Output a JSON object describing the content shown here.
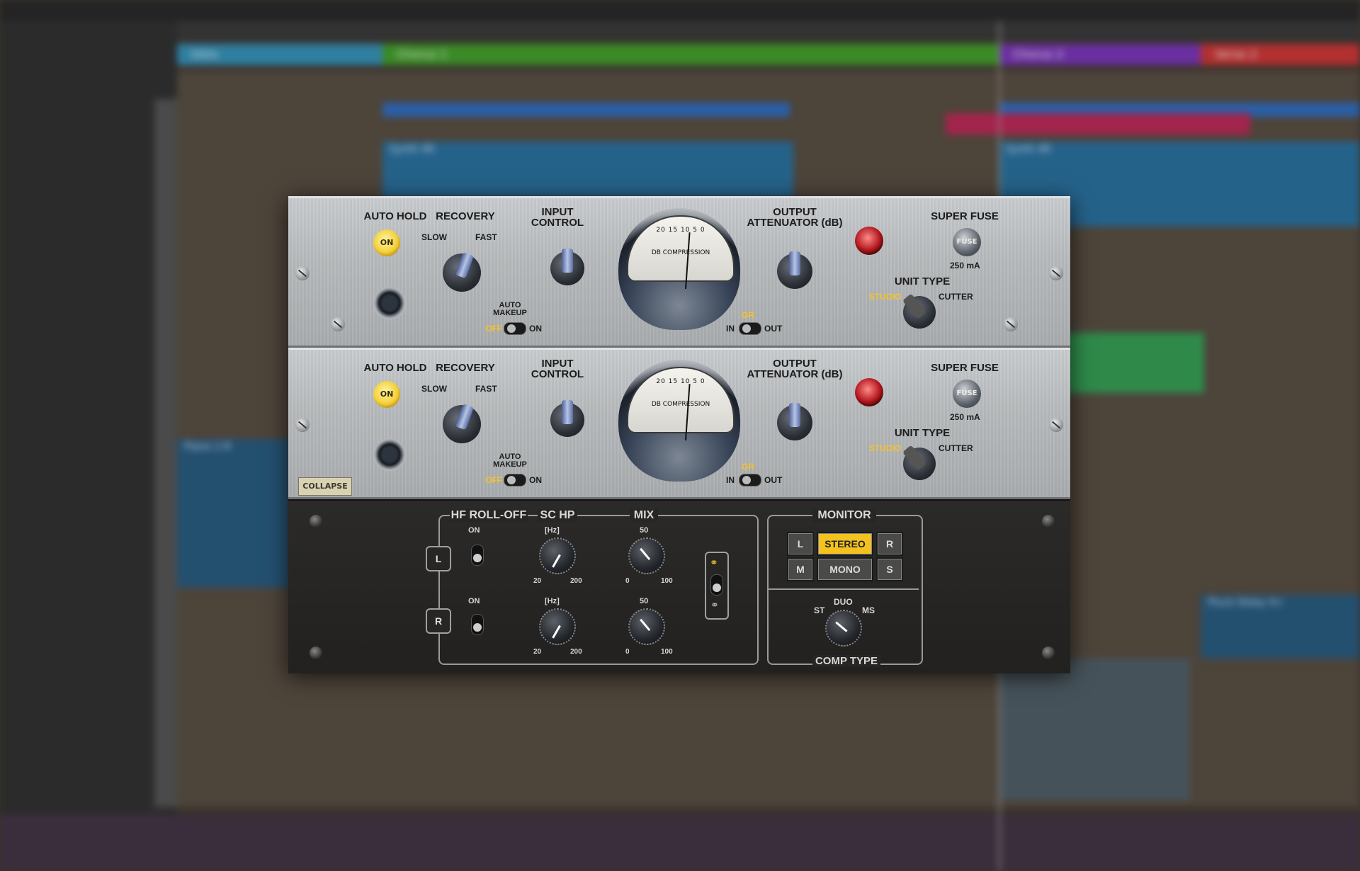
{
  "daw": {
    "regions": {
      "intro": "Intro",
      "chorus1": "Chorus 1",
      "chorus2": "Chorus 2",
      "verse2": "Verse 2"
    },
    "clips": {
      "synth1": "Synth 4R",
      "synth2": "Synth 4R",
      "synth3": "Synth 4R",
      "piano": "Piano 1-R",
      "pluck": "Pluck Delay 4+"
    }
  },
  "plugin": {
    "rack_top": {
      "auto_hold": "AUTO HOLD",
      "auto_hold_led": "ON",
      "recovery": "RECOVERY",
      "slow": "SLOW",
      "fast": "FAST",
      "input_control": "INPUT CONTROL",
      "auto_makeup": "AUTO MAKEUP",
      "off": "OFF",
      "on": "ON",
      "meter_title": "DB COMPRESSION",
      "meter_scale": "20  15  10  5  0",
      "output_attenuator": "OUTPUT ATTENUATOR (dB)",
      "gr": "GR",
      "in": "IN",
      "out": "OUT",
      "super_fuse": "SUPER FUSE",
      "fuse": "FUSE",
      "fuse_value": "250 mA",
      "unit_type": "UNIT TYPE",
      "studio": "STUDIO",
      "cutter": "CUTTER"
    },
    "rack_bottom": {
      "auto_hold": "AUTO HOLD",
      "auto_hold_led": "ON",
      "recovery": "RECOVERY",
      "slow": "SLOW",
      "fast": "FAST",
      "input_control": "INPUT CONTROL",
      "auto_makeup": "AUTO MAKEUP",
      "off": "OFF",
      "on": "ON",
      "meter_title": "DB COMPRESSION",
      "meter_scale": "20  15  10  5  0",
      "output_attenuator": "OUTPUT ATTENUATOR (dB)",
      "gr": "GR",
      "in": "IN",
      "out": "OUT",
      "super_fuse": "SUPER FUSE",
      "fuse": "FUSE",
      "fuse_value": "250 mA",
      "unit_type": "UNIT TYPE",
      "studio": "STUDIO",
      "cutter": "CUTTER",
      "collapse": "COLLAPSE"
    },
    "control_bar": {
      "hf_rolloff": "HF ROLL-OFF",
      "sc_hp": "SC HP",
      "mix": "MIX",
      "ch_l": "L",
      "ch_r": "R",
      "on_l": "ON",
      "on_r": "ON",
      "hz_l": "[Hz]",
      "hz_r": "[Hz]",
      "sc_min": "20",
      "sc_max": "200",
      "mix_top": "50",
      "mix_min": "0",
      "mix_max": "100",
      "monitor": "MONITOR",
      "mon_l": "L",
      "mon_stereo": "STEREO",
      "mon_r": "R",
      "mon_m": "M",
      "mon_mono": "MONO",
      "mon_s": "S",
      "duo": "DUO",
      "st": "ST",
      "ms": "MS",
      "comp_type": "COMP TYPE"
    }
  }
}
